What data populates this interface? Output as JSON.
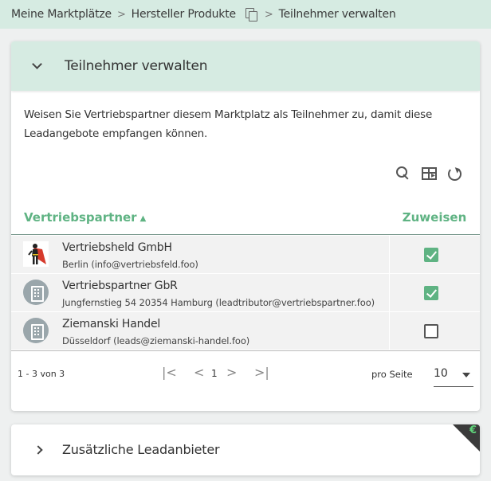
{
  "breadcrumb": {
    "item1": "Meine Marktplätze",
    "sep": ">",
    "item2": "Hersteller Produkte",
    "item3": "Teilnehmer verwalten"
  },
  "panel": {
    "title": "Teilnehmer verwalten",
    "description": "Weisen Sie Vertriebspartner diesem Marktplatz als Teilnehmer zu, damit diese Leadangebote empfangen können."
  },
  "table": {
    "col_partner": "Vertriebspartner",
    "col_assign": "Zuweisen",
    "sort_indicator": "▲",
    "rows": [
      {
        "name": "Vertriebsheld GmbH",
        "detail": "Berlin (info@vertriebsfeld.foo)",
        "assigned": true,
        "avatar": "superhero-logo"
      },
      {
        "name": "Vertriebspartner GbR",
        "detail": "Jungfernstieg 54 20354 Hamburg (leadtributor@vertriebspartner.foo)",
        "assigned": true,
        "avatar": "building-icon"
      },
      {
        "name": "Ziemanski Handel",
        "detail": "Düsseldorf (leads@ziemanski-handel.foo)",
        "assigned": false,
        "avatar": "building-icon"
      }
    ]
  },
  "pagination": {
    "range": "1 - 3 von 3",
    "first": "|<",
    "prev": "<",
    "page": "1",
    "next": ">",
    "last": ">|",
    "per_page_label": "pro Seite",
    "per_page_value": "10"
  },
  "section2": {
    "title": "Zusätzliche Leadanbieter",
    "badge": "€"
  },
  "colors": {
    "accent": "#5fb383",
    "header_bg": "#d6ebe2",
    "row_bg": "#f2f2f2"
  }
}
